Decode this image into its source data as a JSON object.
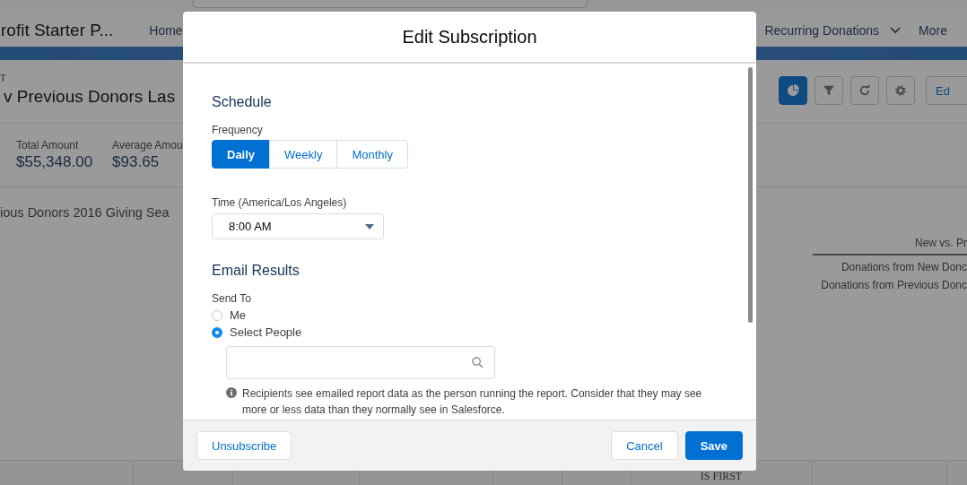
{
  "background": {
    "nav": {
      "app_name": "rofit Starter P...",
      "items": [
        {
          "label": "Home",
          "dropdown": false
        },
        {
          "label": "Recurring Donations",
          "dropdown": true
        },
        {
          "label": "More",
          "dropdown": false
        }
      ]
    },
    "report": {
      "eyebrow": "T",
      "title": "v Previous Donors Las",
      "toolbar": [
        {
          "kind": "chart",
          "selected": true
        },
        {
          "kind": "filter",
          "selected": false
        },
        {
          "kind": "refresh",
          "selected": false
        },
        {
          "kind": "settings",
          "selected": false
        },
        {
          "kind": "text",
          "label": "Ed",
          "selected": false
        }
      ],
      "stats": [
        {
          "label": "Total Amount",
          "value": "$55,348.00"
        },
        {
          "label": "Average Amou",
          "value": "$93.65"
        }
      ],
      "chart_title": "ious Donors 2016 Giving Sea",
      "legend": {
        "title": "New vs. Pr",
        "items": [
          "Donations from New Donc",
          "Donations from Previous Donc"
        ]
      },
      "table_header": "IS FIRST"
    }
  },
  "modal": {
    "title": "Edit Subscription",
    "schedule": {
      "heading": "Schedule",
      "frequency_label": "Frequency",
      "frequency": [
        {
          "label": "Daily",
          "selected": true
        },
        {
          "label": "Weekly",
          "selected": false
        },
        {
          "label": "Monthly",
          "selected": false
        }
      ],
      "time_label": "Time (America/Los Angeles)",
      "time_value": "8:00 AM"
    },
    "email": {
      "heading": "Email Results",
      "send_to_label": "Send To",
      "options": [
        {
          "label": "Me",
          "selected": false
        },
        {
          "label": "Select People",
          "selected": true
        }
      ],
      "info": "Recipients see emailed report data as the person running the report. Consider that they may see more or less data than they normally see in Salesforce."
    },
    "footer": {
      "left_buttons": [
        {
          "label": "Unsubscribe",
          "kind": "neutral"
        }
      ],
      "right_buttons": [
        {
          "label": "Cancel",
          "kind": "neutral"
        },
        {
          "label": "Save",
          "kind": "brand"
        }
      ]
    }
  }
}
